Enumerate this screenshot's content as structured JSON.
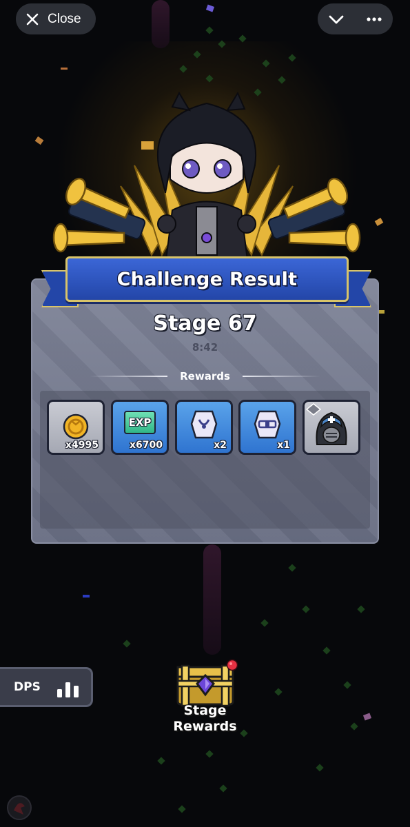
{
  "top_bar": {
    "close_label": "Close",
    "close_icon": "close-x-icon",
    "menu_icons": [
      "chevron-down-icon",
      "more-dots-icon"
    ]
  },
  "result": {
    "banner_title": "Challenge Result",
    "stage": "Stage 67",
    "time": "8:42",
    "rewards_label": "Rewards",
    "rewards": [
      {
        "icon": "gold-coin-icon",
        "qty": "x4995",
        "frame": "gray"
      },
      {
        "icon": "exp-icon",
        "icon_text": "EXP",
        "qty": "x6700",
        "frame": "blue"
      },
      {
        "icon": "necklace-stone-icon",
        "qty": "x2",
        "frame": "blue"
      },
      {
        "icon": "belt-stone-icon",
        "qty": "x1",
        "frame": "blue"
      },
      {
        "icon": "hooded-helmet-icon",
        "qty": "",
        "frame": "gray"
      }
    ]
  },
  "hud": {
    "dps_label": "DPS",
    "dps_icon": "bar-chart-icon",
    "stage_rewards_label_line1": "Stage",
    "stage_rewards_label_line2": "Rewards",
    "stage_rewards_icon": "treasure-chest-icon",
    "notification_dot": true
  },
  "colors": {
    "banner_blue": "#2f57c4",
    "banner_border": "#d8c46a",
    "slot_blue": "#3f87dc",
    "slot_gray": "#b8bac3",
    "panel_gray": "#74798e",
    "notification_red": "#e53042"
  }
}
